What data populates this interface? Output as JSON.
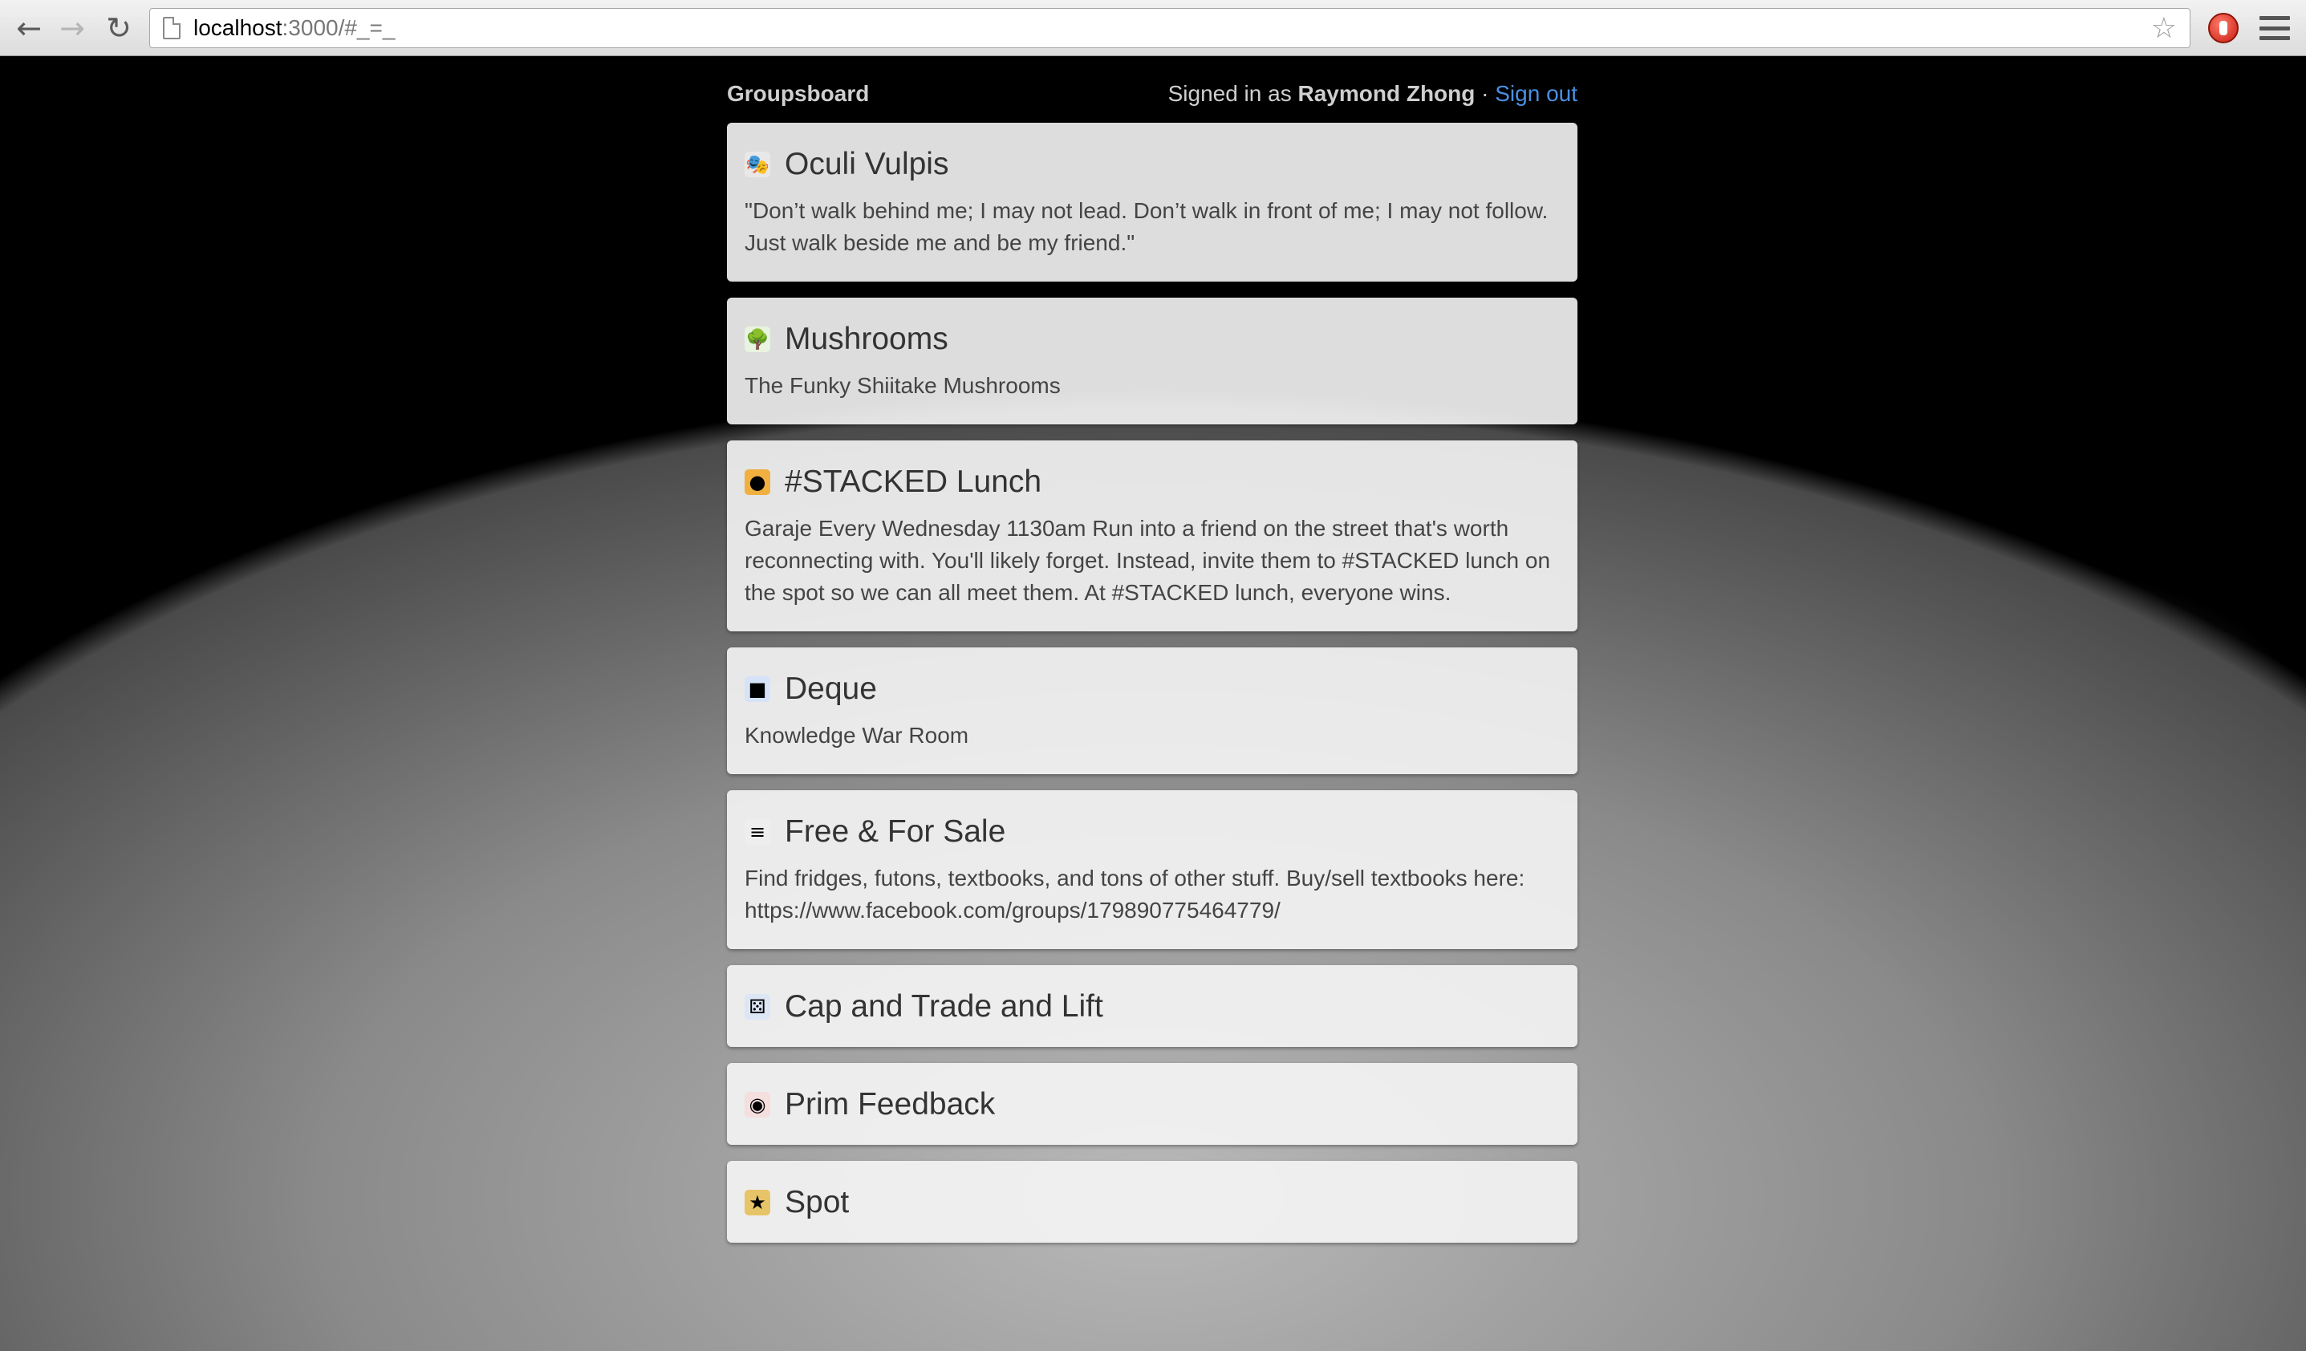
{
  "browser": {
    "url_host": "localhost",
    "url_rest": ":3000/#_=_",
    "icons": {
      "back": "back-arrow-icon",
      "forward": "forward-arrow-icon",
      "reload": "reload-icon",
      "page": "page-icon",
      "star": "star-icon",
      "extension": "stop-extension-icon",
      "menu": "menu-icon"
    }
  },
  "header": {
    "brand": "Groupsboard",
    "signed_in_prefix": "Signed in as ",
    "user_name": "Raymond Zhong",
    "separator": " · ",
    "sign_out": "Sign out"
  },
  "groups": [
    {
      "title": "Oculi Vulpis",
      "icon": "theater-masks-icon",
      "glyph": "🎭",
      "color": "#e8e8e8",
      "description": "\"Don’t walk behind me; I may not lead. Don’t walk in front of me; I may not follow. Just walk beside me and be my friend.\""
    },
    {
      "title": "Mushrooms",
      "icon": "tree-icon",
      "glyph": "🌳",
      "color": "#e8f3e0",
      "description": "The Funky Shiitake Mushrooms"
    },
    {
      "title": "#STACKED Lunch",
      "icon": "coin-icon",
      "glyph": "●",
      "color": "#f0b040",
      "description": "Garaje Every Wednesday 1130am Run into a friend on the street that's worth reconnecting with. You'll likely forget. Instead, invite them to #STACKED lunch on the spot so we can all meet them. At #STACKED lunch, everyone wins."
    },
    {
      "title": "Deque",
      "icon": "book-icon",
      "glyph": "■",
      "color": "#d6e2f8",
      "description": "Knowledge War Room"
    },
    {
      "title": "Free & For Sale",
      "icon": "receipt-icon",
      "glyph": "≡",
      "color": "#eeeeee",
      "description": "Find fridges, futons, textbooks, and tons of other stuff. Buy/sell textbooks here: https://www.facebook.com/groups/179890775464779/"
    },
    {
      "title": "Cap and Trade and Lift",
      "icon": "dice-icon",
      "glyph": "⚄",
      "color": "#dde6f5",
      "description": ""
    },
    {
      "title": "Prim Feedback",
      "icon": "target-icon",
      "glyph": "◉",
      "color": "#f5dede",
      "description": ""
    },
    {
      "title": "Spot",
      "icon": "star-badge-icon",
      "glyph": "★",
      "color": "#e8c468",
      "description": ""
    }
  ]
}
